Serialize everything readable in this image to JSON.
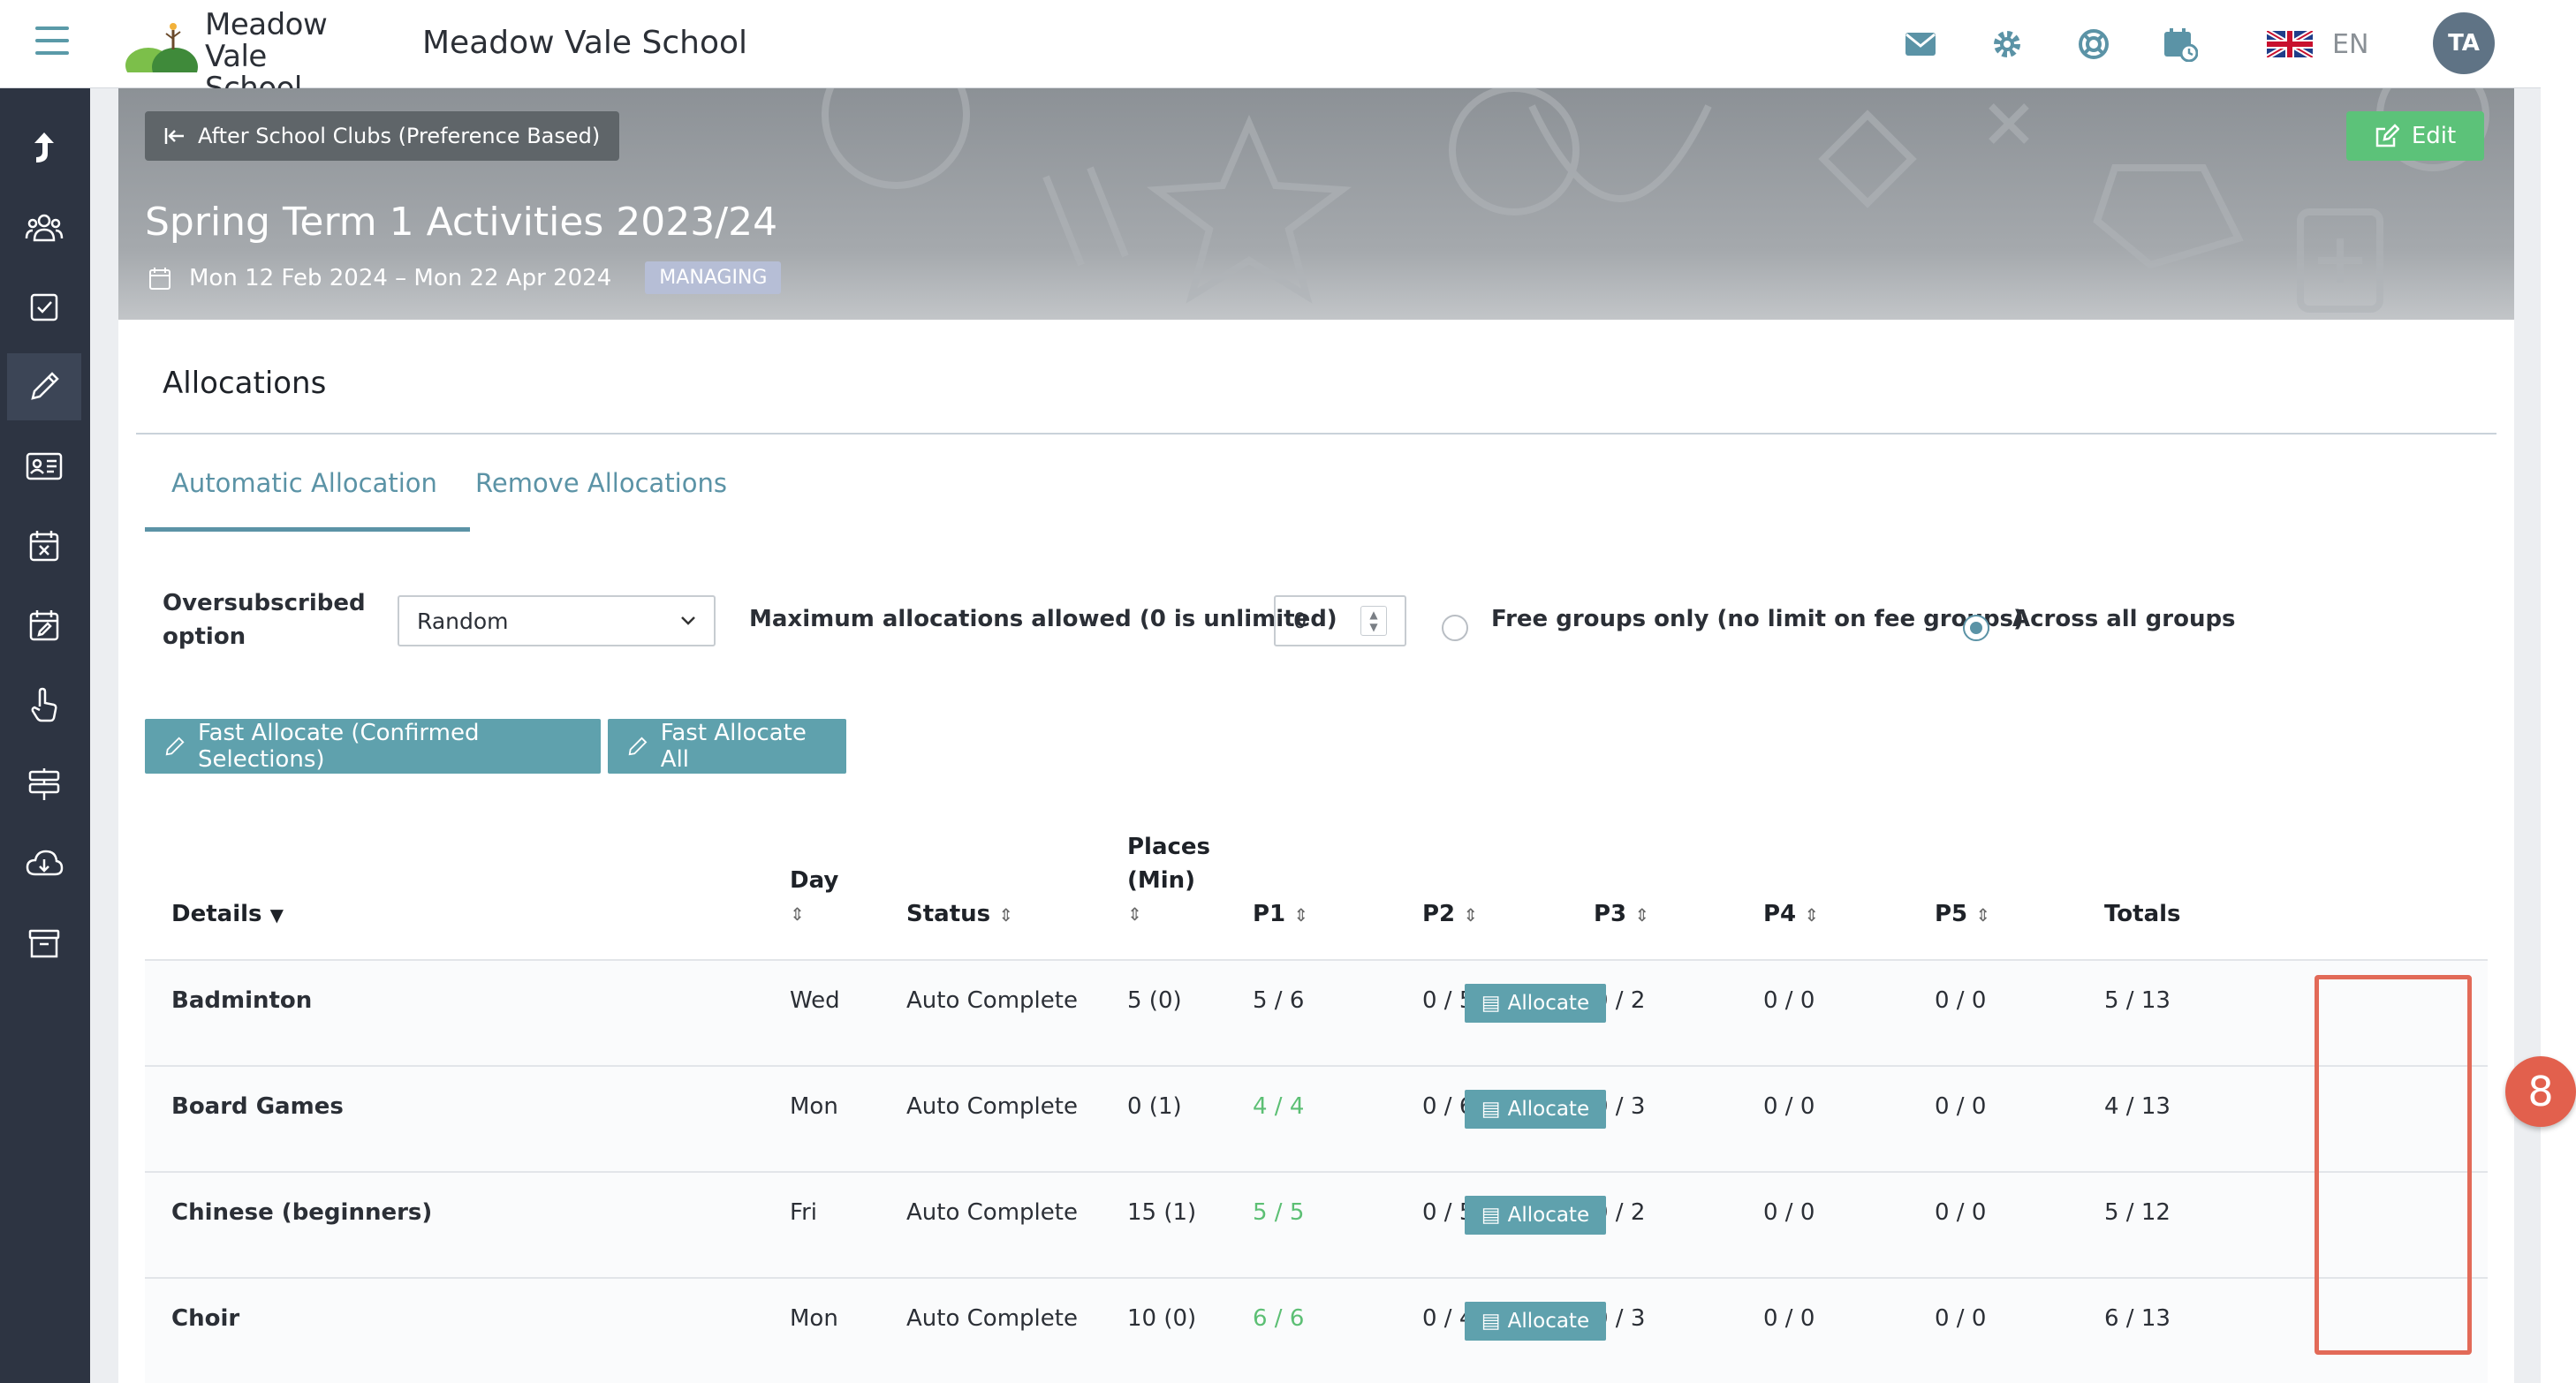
{
  "header": {
    "logo_line1": "Meadow",
    "logo_line2": "Vale School",
    "school_name": "Meadow Vale School",
    "icons": [
      "mail-icon",
      "settings-icon",
      "help-icon",
      "calendar-clock-icon"
    ],
    "language": "EN",
    "user_initials": "TA"
  },
  "sidebar": {
    "items": [
      "switch-icon",
      "people-icon",
      "checkbox-icon",
      "pencil-icon",
      "id-card-icon",
      "calendar-x-icon",
      "calendar-edit-icon",
      "hand-pointer-icon",
      "signpost-icon",
      "cloud-download-icon",
      "archive-icon"
    ],
    "active": "pencil-icon"
  },
  "banner": {
    "back_label": "After School Clubs (Preference Based)",
    "edit_label": "Edit",
    "title": "Spring Term 1 Activities 2023/24",
    "dates": "Mon 12 Feb 2024 – Mon 22 Apr 2024",
    "badge": "MANAGING"
  },
  "allocations": {
    "title": "Allocations",
    "tabs": [
      "Automatic Allocation",
      "Remove Allocations"
    ],
    "active_tab": "Automatic Allocation",
    "oversubscribed_label": "Oversubscribed option",
    "oversubscribed_value": "Random",
    "max_label": "Maximum allocations allowed (0 is unlimited)",
    "max_value": "0",
    "radio_free": "Free groups only (no limit on fee groups)",
    "radio_all": "Across all groups",
    "selected_radio": "Across all groups",
    "btn_fast_confirmed": "Fast Allocate (Confirmed Selections)",
    "btn_fast_all": "Fast Allocate All"
  },
  "table": {
    "headers": {
      "details": "Details",
      "day": "Day",
      "status": "Status",
      "places": "Places (Min)",
      "places_line1": "Places",
      "places_line2": "(Min)",
      "p1": "P1",
      "p2": "P2",
      "p3": "P3",
      "p4": "P4",
      "p5": "P5",
      "totals": "Totals"
    },
    "allocate_label": "Allocate",
    "rows": [
      {
        "details": "Badminton",
        "day": "Wed",
        "status": "Auto Complete",
        "places": "5 (0)",
        "p1": "5 / 6",
        "p2": "0 / 5",
        "p3": "0 / 2",
        "p4": "0 / 0",
        "p5": "0 / 0",
        "totals": "5 / 13",
        "p1_full": false
      },
      {
        "details": "Board Games",
        "day": "Mon",
        "status": "Auto Complete",
        "places": "0 (1)",
        "p1": "4 / 4",
        "p2": "0 / 6",
        "p3": "0 / 3",
        "p4": "0 / 0",
        "p5": "0 / 0",
        "totals": "4 / 13",
        "p1_full": true
      },
      {
        "details": "Chinese (beginners)",
        "day": "Fri",
        "status": "Auto Complete",
        "places": "15 (1)",
        "p1": "5 / 5",
        "p2": "0 / 5",
        "p3": "0 / 2",
        "p4": "0 / 0",
        "p5": "0 / 0",
        "totals": "5 / 12",
        "p1_full": true
      },
      {
        "details": "Choir",
        "day": "Mon",
        "status": "Auto Complete",
        "places": "10 (0)",
        "p1": "6 / 6",
        "p2": "0 / 4",
        "p3": "0 / 3",
        "p4": "0 / 0",
        "p5": "0 / 0",
        "totals": "6 / 13",
        "p1_full": true
      }
    ]
  },
  "step_badge": "8",
  "colors": {
    "accent": "#5b93a6",
    "button": "#5fa1ad",
    "edit_green": "#5cc279",
    "highlight": "#e26a58",
    "full_green": "#5cbf74"
  }
}
